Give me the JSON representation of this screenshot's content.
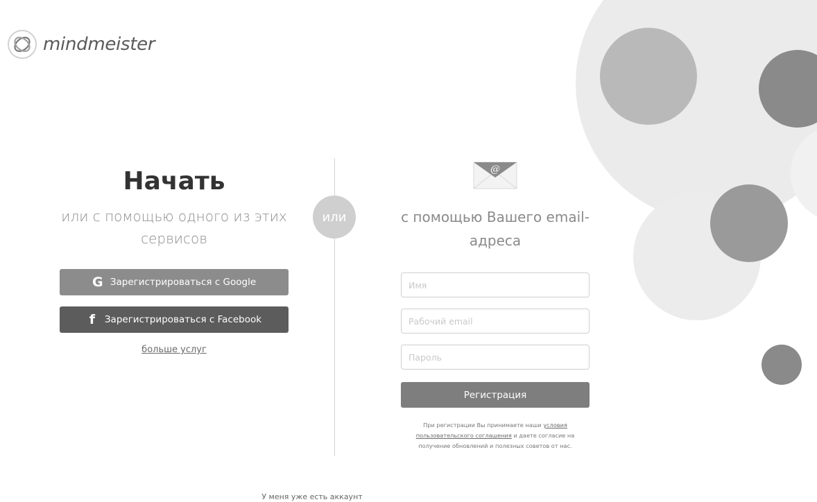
{
  "brand": {
    "name_part1": "mind",
    "name_part2": "meister"
  },
  "left": {
    "heading": "Начать",
    "subheading": "или с помощью одного из этих сервисов",
    "google_label": "Зарегистрироваться с Google",
    "google_icon": "G",
    "facebook_label": "Зарегистрироваться с Facebook",
    "facebook_icon": "f",
    "more_services": "больше услуг"
  },
  "separator": {
    "label": "или"
  },
  "right": {
    "title": "с помощью Вашего email-адреса",
    "name_placeholder": "Имя",
    "email_placeholder": "Рабочий email",
    "password_placeholder": "Пароль",
    "submit_label": "Регистрация",
    "terms_prefix": "При регистрации Вы принимаете наши ",
    "terms_link": "условия пользовательского соглашения",
    "terms_suffix": " и даете согласие на получение обновлений и полезных советов от нас."
  },
  "footer": {
    "have_account": "У меня уже есть аккаунт"
  },
  "colors": {
    "google_button": "#8c8c8c",
    "facebook_button": "#5c5c5c",
    "submit_button": "#7e7e7e",
    "or_badge": "#cfcfcf"
  },
  "icons": {
    "logo": "mindmeister-logo-icon",
    "email": "email-envelope-icon"
  }
}
